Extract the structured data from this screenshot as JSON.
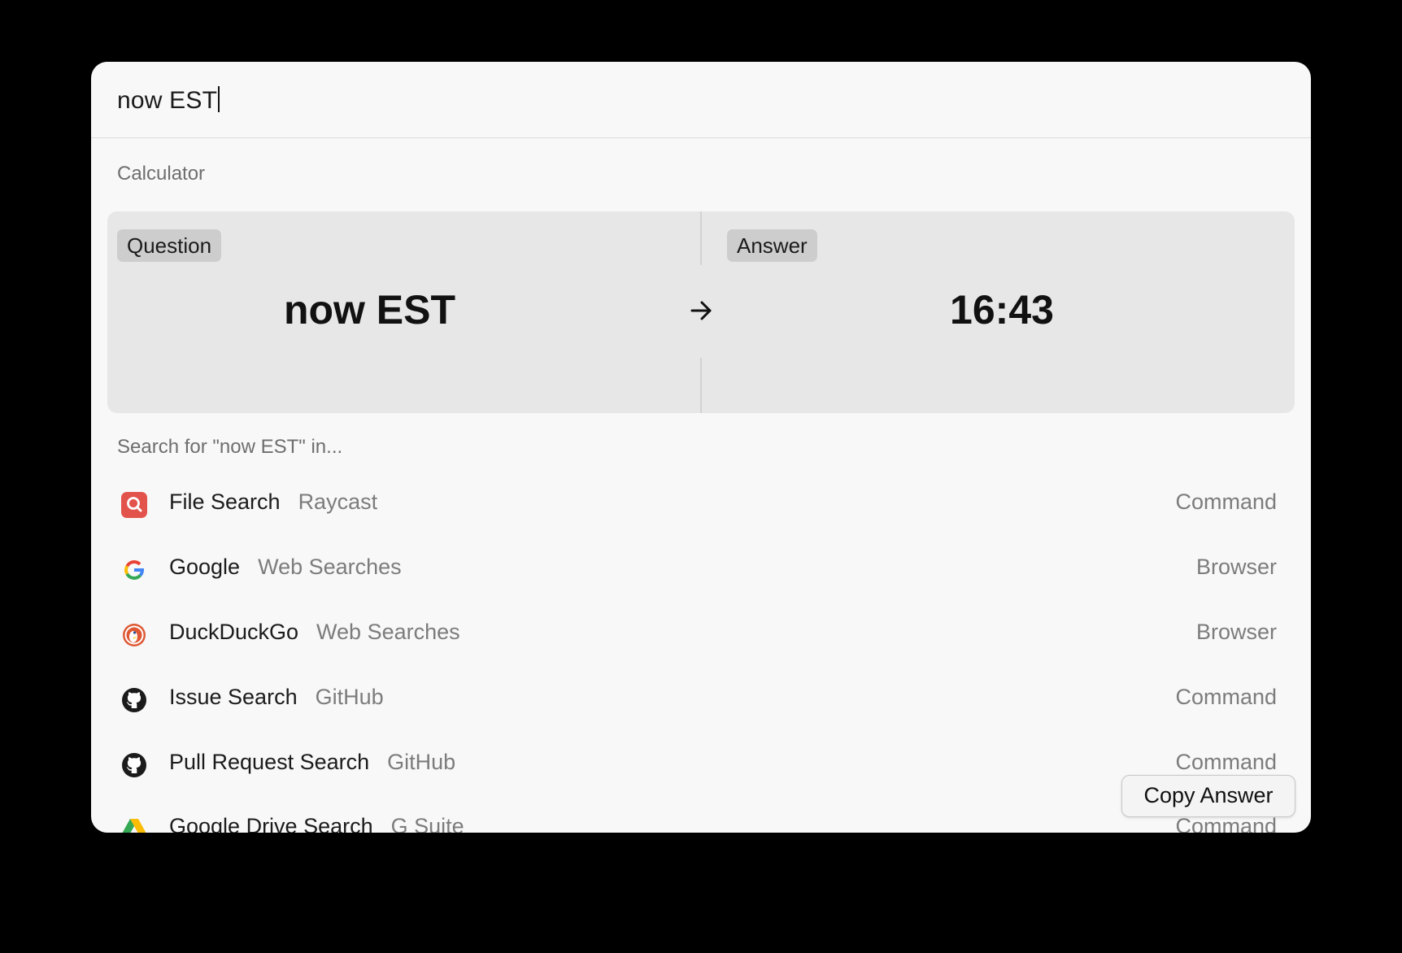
{
  "search": {
    "query": "now EST"
  },
  "calculator": {
    "section_title": "Calculator",
    "question_label": "Question",
    "question_value": "now EST",
    "answer_label": "Answer",
    "answer_value": "16:43"
  },
  "search_in": {
    "section_title": "Search for \"now EST\" in...",
    "items": [
      {
        "title": "File Search",
        "subtitle": "Raycast",
        "accessory": "Command",
        "icon": "file-search-icon"
      },
      {
        "title": "Google",
        "subtitle": "Web Searches",
        "accessory": "Browser",
        "icon": "google-icon"
      },
      {
        "title": "DuckDuckGo",
        "subtitle": "Web Searches",
        "accessory": "Browser",
        "icon": "duckduckgo-icon"
      },
      {
        "title": "Issue Search",
        "subtitle": "GitHub",
        "accessory": "Command",
        "icon": "github-icon"
      },
      {
        "title": "Pull Request Search",
        "subtitle": "GitHub",
        "accessory": "Command",
        "icon": "github-icon"
      },
      {
        "title": "Google Drive Search",
        "subtitle": "G Suite",
        "accessory": "Command",
        "icon": "google-drive-icon"
      }
    ]
  },
  "action": {
    "copy_label": "Copy Answer"
  },
  "colors": {
    "background": "#000000",
    "window": "#f8f8f8",
    "card": "#e7e7e7",
    "pill": "#cdcdcd",
    "raycast_red": "#e2534b"
  }
}
